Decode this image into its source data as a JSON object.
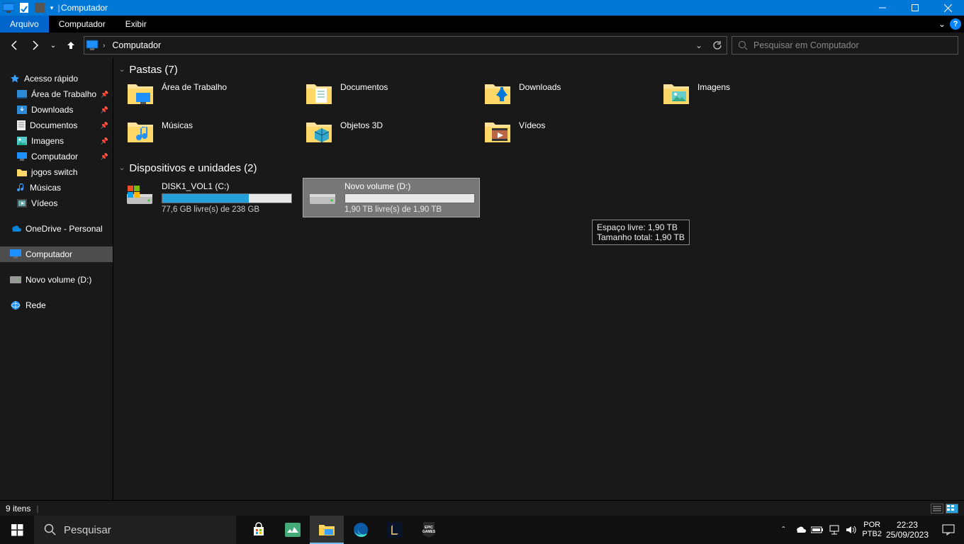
{
  "titlebar": {
    "title": "Computador"
  },
  "ribbon": {
    "file": "Arquivo",
    "tabs": [
      "Computador",
      "Exibir"
    ]
  },
  "address": {
    "crumb": "Computador"
  },
  "search": {
    "placeholder": "Pesquisar em Computador"
  },
  "sidebar": {
    "quick_access": "Acesso rápido",
    "pinned": [
      "Área de Trabalho",
      "Downloads",
      "Documentos",
      "Imagens",
      "Computador",
      "jogos switch",
      "Músicas",
      "Vídeos"
    ],
    "onedrive": "OneDrive - Personal",
    "this_pc": "Computador",
    "new_volume": "Novo volume (D:)",
    "network": "Rede"
  },
  "groups": {
    "folders_header": "Pastas (7)",
    "devices_header": "Dispositivos e unidades (2)"
  },
  "folders": [
    "Área de Trabalho",
    "Documentos",
    "Downloads",
    "Imagens",
    "Músicas",
    "Objetos 3D",
    "Vídeos"
  ],
  "drives": [
    {
      "name": "DISK1_VOL1 (C:)",
      "sub": "77,6 GB livre(s) de 238 GB",
      "fill_pct": 67
    },
    {
      "name": "Novo volume (D:)",
      "sub": "1,90 TB livre(s) de 1,90 TB",
      "fill_pct": 0
    }
  ],
  "tooltip": {
    "line1": "Espaço livre: 1,90 TB",
    "line2": "Tamanho total: 1,90 TB"
  },
  "statusbar": {
    "count": "9 itens"
  },
  "taskbar": {
    "search_placeholder": "Pesquisar",
    "lang1": "POR",
    "lang2": "PTB2",
    "time": "22:23",
    "date": "25/09/2023"
  }
}
